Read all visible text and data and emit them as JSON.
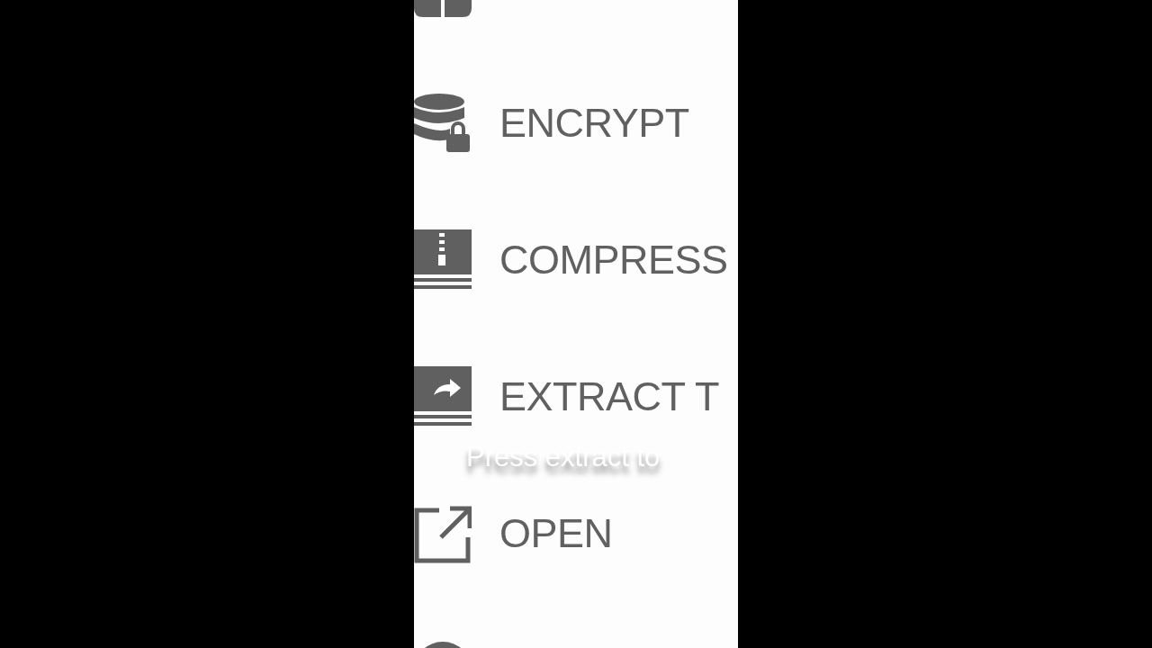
{
  "menu": {
    "items": [
      {
        "kind": "encrypt_to"
      },
      {
        "kind": "encrypt",
        "label": "ENCRYPT"
      },
      {
        "kind": "compress",
        "label": "COMPRESS"
      },
      {
        "kind": "extract",
        "label": "EXTRACT T"
      },
      {
        "kind": "open",
        "label": "OPEN"
      },
      {
        "kind": "info"
      }
    ]
  },
  "caption": "Press extract to"
}
